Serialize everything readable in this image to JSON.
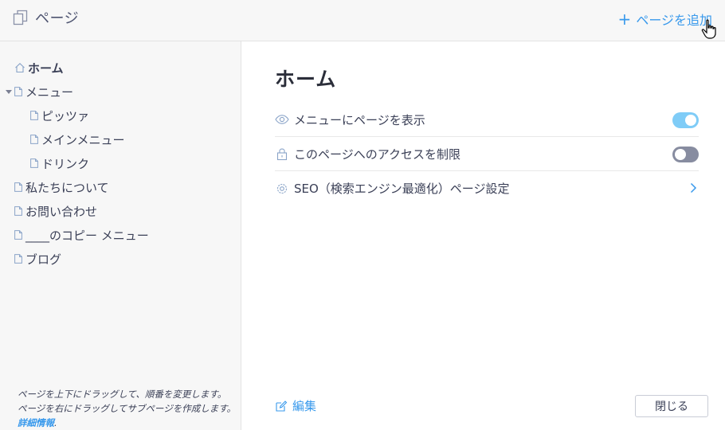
{
  "header": {
    "title": "ページ",
    "add_page_label": "ページを追加",
    "add_icon": "plus-icon",
    "title_icon": "pages-icon"
  },
  "sidebar": {
    "items": [
      {
        "label": "ホーム",
        "icon": "home-icon",
        "level": 0,
        "selected": true
      },
      {
        "label": "メニュー",
        "icon": "page-icon",
        "level": 0,
        "expanded": true
      },
      {
        "label": "ピッツァ",
        "icon": "page-icon",
        "level": 1
      },
      {
        "label": "メインメニュー",
        "icon": "page-icon",
        "level": 1
      },
      {
        "label": "ドリンク",
        "icon": "page-icon",
        "level": 1
      },
      {
        "label": "私たちについて",
        "icon": "page-icon",
        "level": 0
      },
      {
        "label": "お問い合わせ",
        "icon": "page-icon",
        "level": 0
      },
      {
        "label": "____のコピー メニュー",
        "icon": "page-icon",
        "level": 0
      },
      {
        "label": "ブログ",
        "icon": "page-icon",
        "level": 0
      }
    ],
    "hint_line1": "ページを上下にドラッグして、順番を変更します。",
    "hint_line2": "ページを右にドラッグしてサブページを作成します。",
    "hint_link": "詳細情報",
    "hint_period": "."
  },
  "main": {
    "page_title": "ホーム",
    "settings": [
      {
        "label": "メニューにページを表示",
        "icon": "eye-icon",
        "control": "toggle",
        "on": true
      },
      {
        "label": "このページへのアクセスを制限",
        "icon": "lock-icon",
        "control": "toggle",
        "on": false
      },
      {
        "label": "SEO（検索エンジン最適化）ページ設定",
        "icon": "gear-icon",
        "control": "chevron"
      }
    ],
    "edit_label": "編集",
    "close_label": "閉じる"
  },
  "colors": {
    "accent": "#3899ec",
    "toggle_on": "#7fccf7",
    "toggle_off": "#878ca0",
    "panel_bg": "#f7f7f7"
  }
}
